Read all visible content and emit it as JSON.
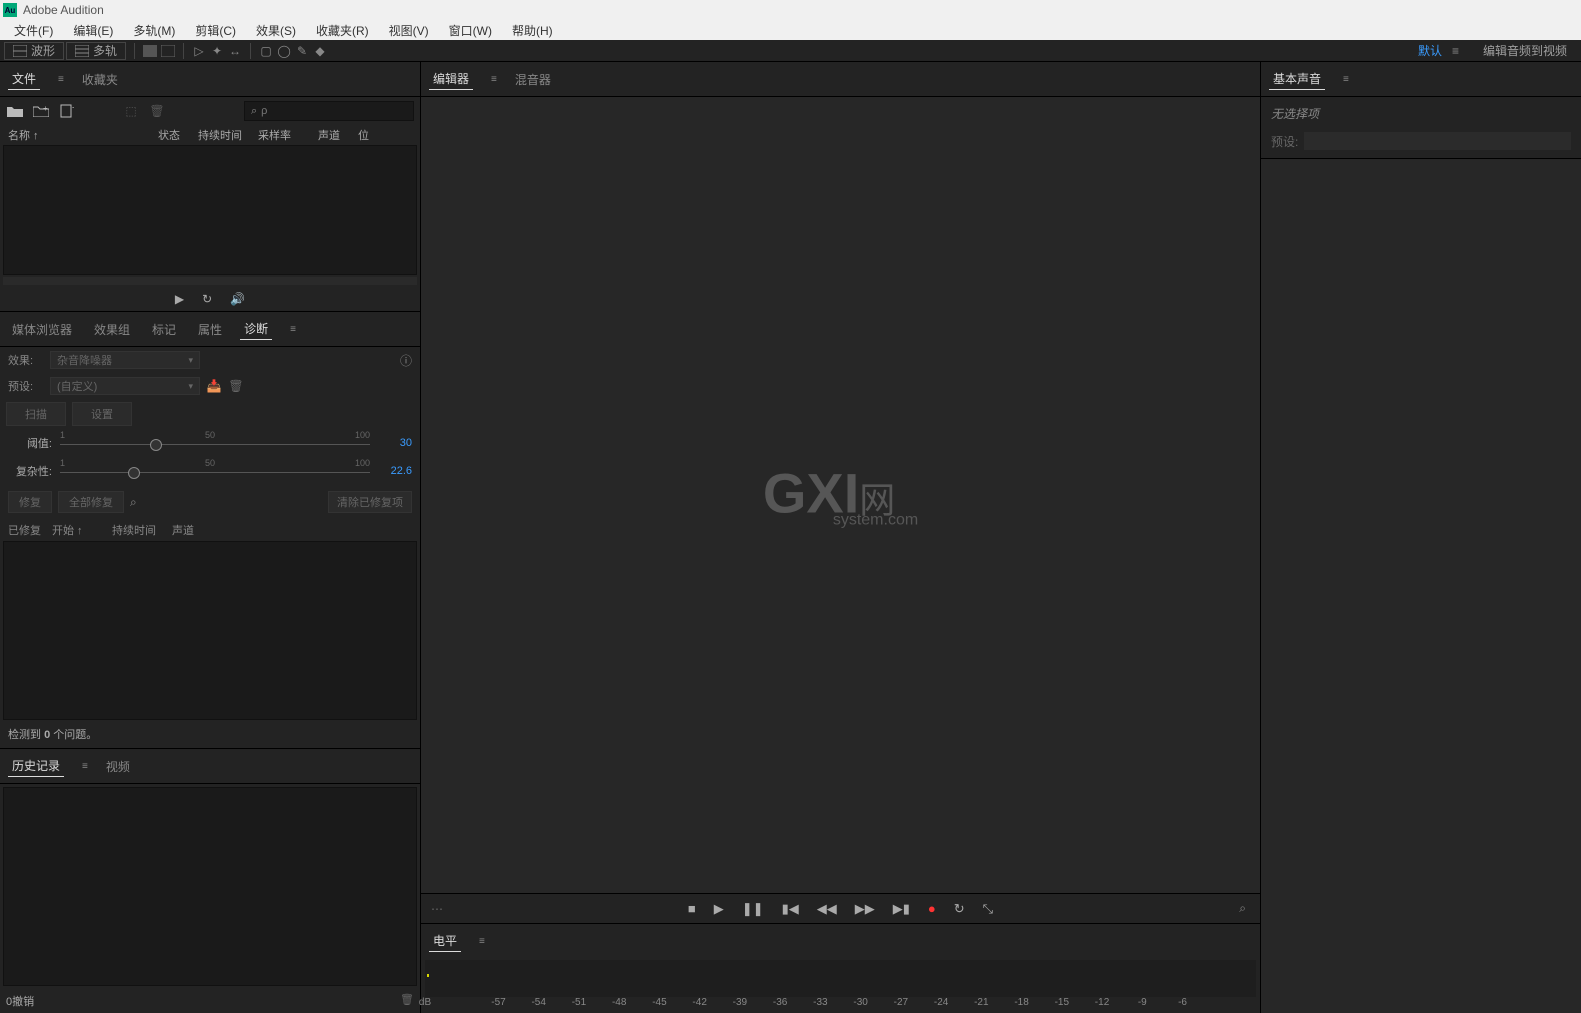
{
  "app": {
    "title": "Adobe Audition",
    "logo_text": "Au"
  },
  "menu": {
    "file": "文件(F)",
    "edit": "编辑(E)",
    "multitrack": "多轨(M)",
    "clip": "剪辑(C)",
    "effects": "效果(S)",
    "favorites": "收藏夹(R)",
    "view": "视图(V)",
    "window": "窗口(W)",
    "help": "帮助(H)"
  },
  "toolbar": {
    "waveform": "波形",
    "multitrack": "多轨",
    "default_label": "默认",
    "edit_audio_to_video": "编辑音频到视频"
  },
  "files_panel": {
    "tab_files": "文件",
    "tab_fav": "收藏夹",
    "cols": {
      "name": "名称 ↑",
      "status": "状态",
      "duration": "持续时间",
      "sample": "采样率",
      "channel": "声道",
      "bit": "位"
    },
    "search_placeholder": "ρ"
  },
  "media_tabs": {
    "media": "媒体浏览器",
    "fx": "效果组",
    "markers": "标记",
    "props": "属性",
    "diag": "诊断"
  },
  "diag": {
    "effect_label": "效果:",
    "effect_val": "杂音降噪器",
    "preset_label": "预设:",
    "preset_val": "(自定义)",
    "scan": "扫描",
    "settings": "设置",
    "slider1": {
      "label": "阈值:",
      "min": "1",
      "mid": "50",
      "max": "100",
      "value": "30"
    },
    "slider2": {
      "label": "复杂性:",
      "min": "1",
      "mid": "50",
      "max": "100",
      "value": "22.6"
    },
    "fix": "修复",
    "fix_all": "全部修复",
    "clear": "清除已修复项",
    "cols": {
      "fixed": "已修复",
      "start": "开始 ↑",
      "dur": "持续时间",
      "ch": "声道"
    },
    "status_prefix": "检测到 ",
    "status_count": "0",
    "status_suffix": " 个问题。"
  },
  "history": {
    "tab_history": "历史记录",
    "tab_video": "视频",
    "undo_text": "0撤销"
  },
  "editor": {
    "tab_editor": "编辑器",
    "tab_mixer": "混音器",
    "watermark1": "GXI",
    "watermark2": "网",
    "watermark3": "system.com"
  },
  "levels": {
    "title": "电平",
    "db": "dB",
    "ticks": [
      "-57",
      "-54",
      "-51",
      "-48",
      "-45",
      "-42",
      "-39",
      "-36",
      "-33",
      "-30",
      "-27",
      "-24",
      "-21",
      "-18",
      "-15",
      "-12",
      "-9",
      "-6"
    ]
  },
  "essential_sound": {
    "title": "基本声音",
    "no_selection": "无选择项",
    "preset_label": "预设:"
  }
}
